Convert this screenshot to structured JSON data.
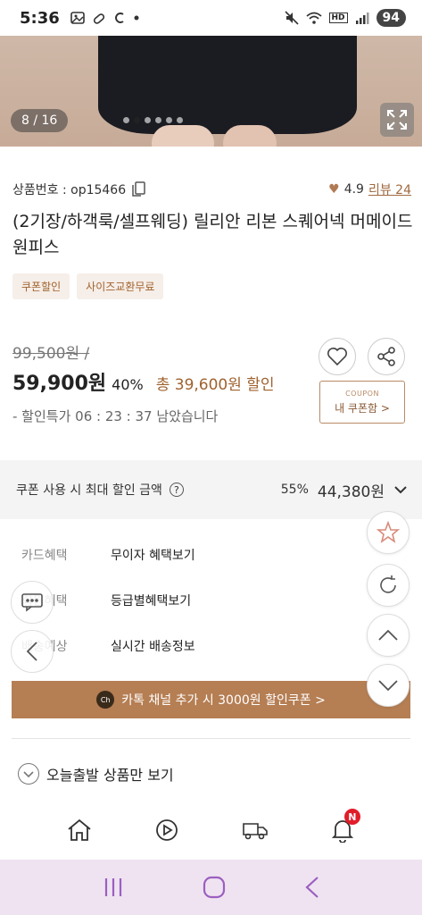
{
  "status_bar": {
    "time": "5:36",
    "left_icons": [
      "gallery-icon",
      "vpn-icon",
      "c-icon",
      "dot-icon"
    ],
    "right_icons": [
      "mute-icon",
      "wifi-icon",
      "hd-voice-icon",
      "signal-icon"
    ],
    "hd_voice": "HD",
    "battery": "94"
  },
  "hero": {
    "counter": "8 / 16",
    "dots_total": 6,
    "active_dot": 1
  },
  "product": {
    "code_label": "상품번호 : op15466",
    "rating": "4.9",
    "review_label": "리뷰 24",
    "title": "(2기장/하객룩/셀프웨딩) 릴리안 리본 스퀘어넥 머메이드 원피스",
    "tags": [
      "쿠폰할인",
      "사이즈교환무료"
    ]
  },
  "price": {
    "original": "99,500원 /",
    "sale": "59,900원",
    "percent": "40%",
    "total_discount": "총 39,600원 할인",
    "timer": "- 할인특가 06 : 23 : 37 남았습니다"
  },
  "coupon": {
    "small": "COUPON",
    "label": "내 쿠폰함 >"
  },
  "max_discount": {
    "label": "쿠폰 사용 시 최대 할인 금액",
    "help": "?",
    "percent": "55%",
    "amount": "44,380원"
  },
  "benefits": [
    {
      "label": "카드혜택",
      "value": "무이자 혜택보기"
    },
    {
      "label": "회원혜택",
      "value": "등급별혜택보기"
    },
    {
      "label": "배송예상",
      "value": "실시간 배송정보"
    }
  ],
  "kakao": {
    "icon_text": "Ch",
    "label": "카톡 채널 추가 시 3000원 할인쿠폰 >"
  },
  "today_only": {
    "label": "오늘출발 상품만 보기"
  },
  "bottom_nav": {
    "items": [
      "home-icon",
      "play-icon",
      "delivery-truck-icon",
      "bell-icon"
    ],
    "badge": "N"
  },
  "colors": {
    "accent": "#b57e53",
    "accent_text": "#a0622e",
    "fab_star": "#d98a7a",
    "badge": "#e11d2a",
    "system_nav_bg": "#efe3f1"
  }
}
